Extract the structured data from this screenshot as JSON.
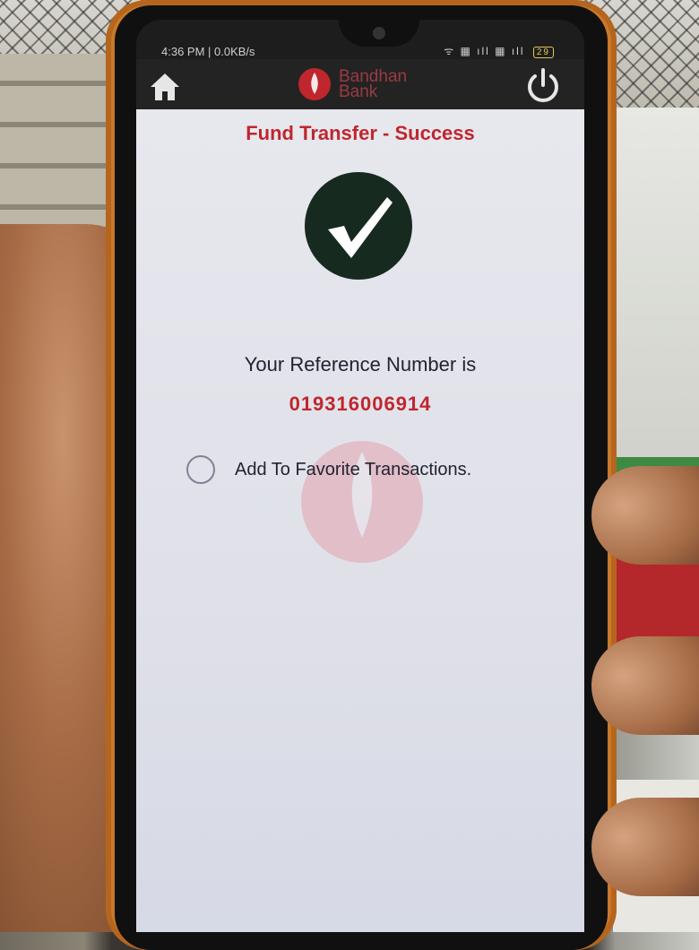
{
  "status_bar": {
    "time_net": "4:36 PM | 0.0KB/s",
    "icons": "ᯤ ▦ ıll ▦ ıll",
    "battery": "29"
  },
  "app_bar": {
    "logo_line1": "Bandhan",
    "logo_line2": "Bank",
    "brand_color": "#c0262e"
  },
  "main": {
    "title": "Fund Transfer - Success",
    "reference_label": "Your Reference Number is",
    "reference_number": "019316006914",
    "favorite_label": "Add To Favorite Transactions.",
    "favorite_checked": false
  },
  "icons": {
    "home": "home-icon",
    "power": "power-icon",
    "success": "checkmark-icon"
  }
}
